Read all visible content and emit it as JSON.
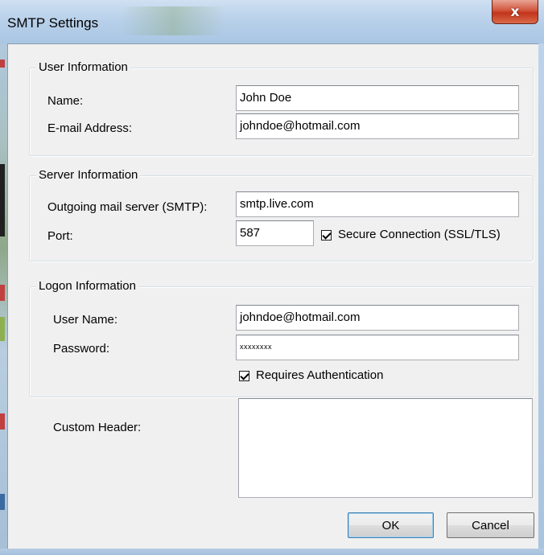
{
  "window": {
    "title": "SMTP Settings",
    "close_label": "x"
  },
  "user_info": {
    "title": "User Information",
    "name_label": "Name:",
    "name_value": "John Doe",
    "email_label": "E-mail Address:",
    "email_value": "johndoe@hotmail.com"
  },
  "server_info": {
    "title": "Server Information",
    "smtp_label": "Outgoing mail server (SMTP):",
    "smtp_value": "smtp.live.com",
    "port_label": "Port:",
    "port_value": "587",
    "secure_label": "Secure Connection (SSL/TLS)",
    "secure_checked": true
  },
  "logon_info": {
    "title": "Logon Information",
    "username_label": "User Name:",
    "username_value": "johndoe@hotmail.com",
    "password_label": "Password:",
    "password_value": "xxxxxxxx",
    "auth_label": "Requires Authentication",
    "auth_checked": true
  },
  "custom": {
    "header_label": "Custom Header:",
    "header_value": ""
  },
  "buttons": {
    "ok": "OK",
    "cancel": "Cancel"
  }
}
